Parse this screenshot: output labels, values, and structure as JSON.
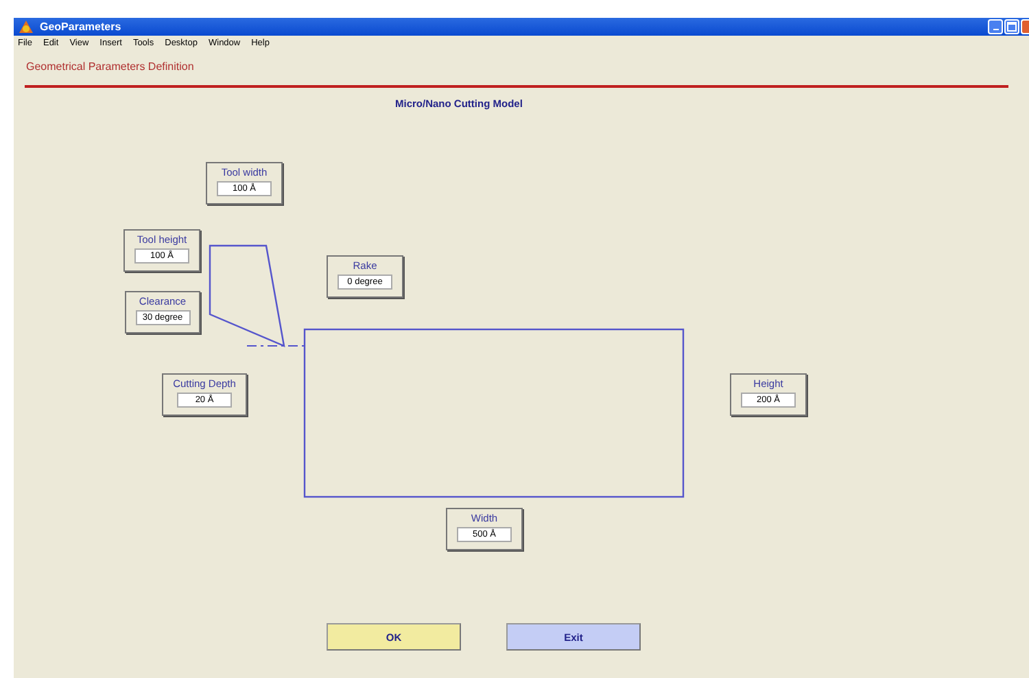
{
  "window": {
    "title": "GeoParameters"
  },
  "menu": [
    "File",
    "Edit",
    "View",
    "Insert",
    "Tools",
    "Desktop",
    "Window",
    "Help"
  ],
  "header": "Geometrical Parameters Definition",
  "model_title": "Micro/Nano Cutting Model",
  "parameters": [
    {
      "label": "Tool width",
      "value": "100 Å"
    },
    {
      "label": "Tool height",
      "value": "100 Å"
    },
    {
      "label": "Clearance",
      "value": "30 degree"
    },
    {
      "label": "Rake",
      "value": "0 degree"
    },
    {
      "label": "Cutting Depth",
      "value": "20 Å"
    },
    {
      "label": "Height",
      "value": "200 Å"
    },
    {
      "label": "Width",
      "value": "500 Å"
    }
  ],
  "buttons": [
    {
      "label": "OK",
      "kind": "ok"
    },
    {
      "label": "Exit",
      "kind": "exit"
    }
  ]
}
